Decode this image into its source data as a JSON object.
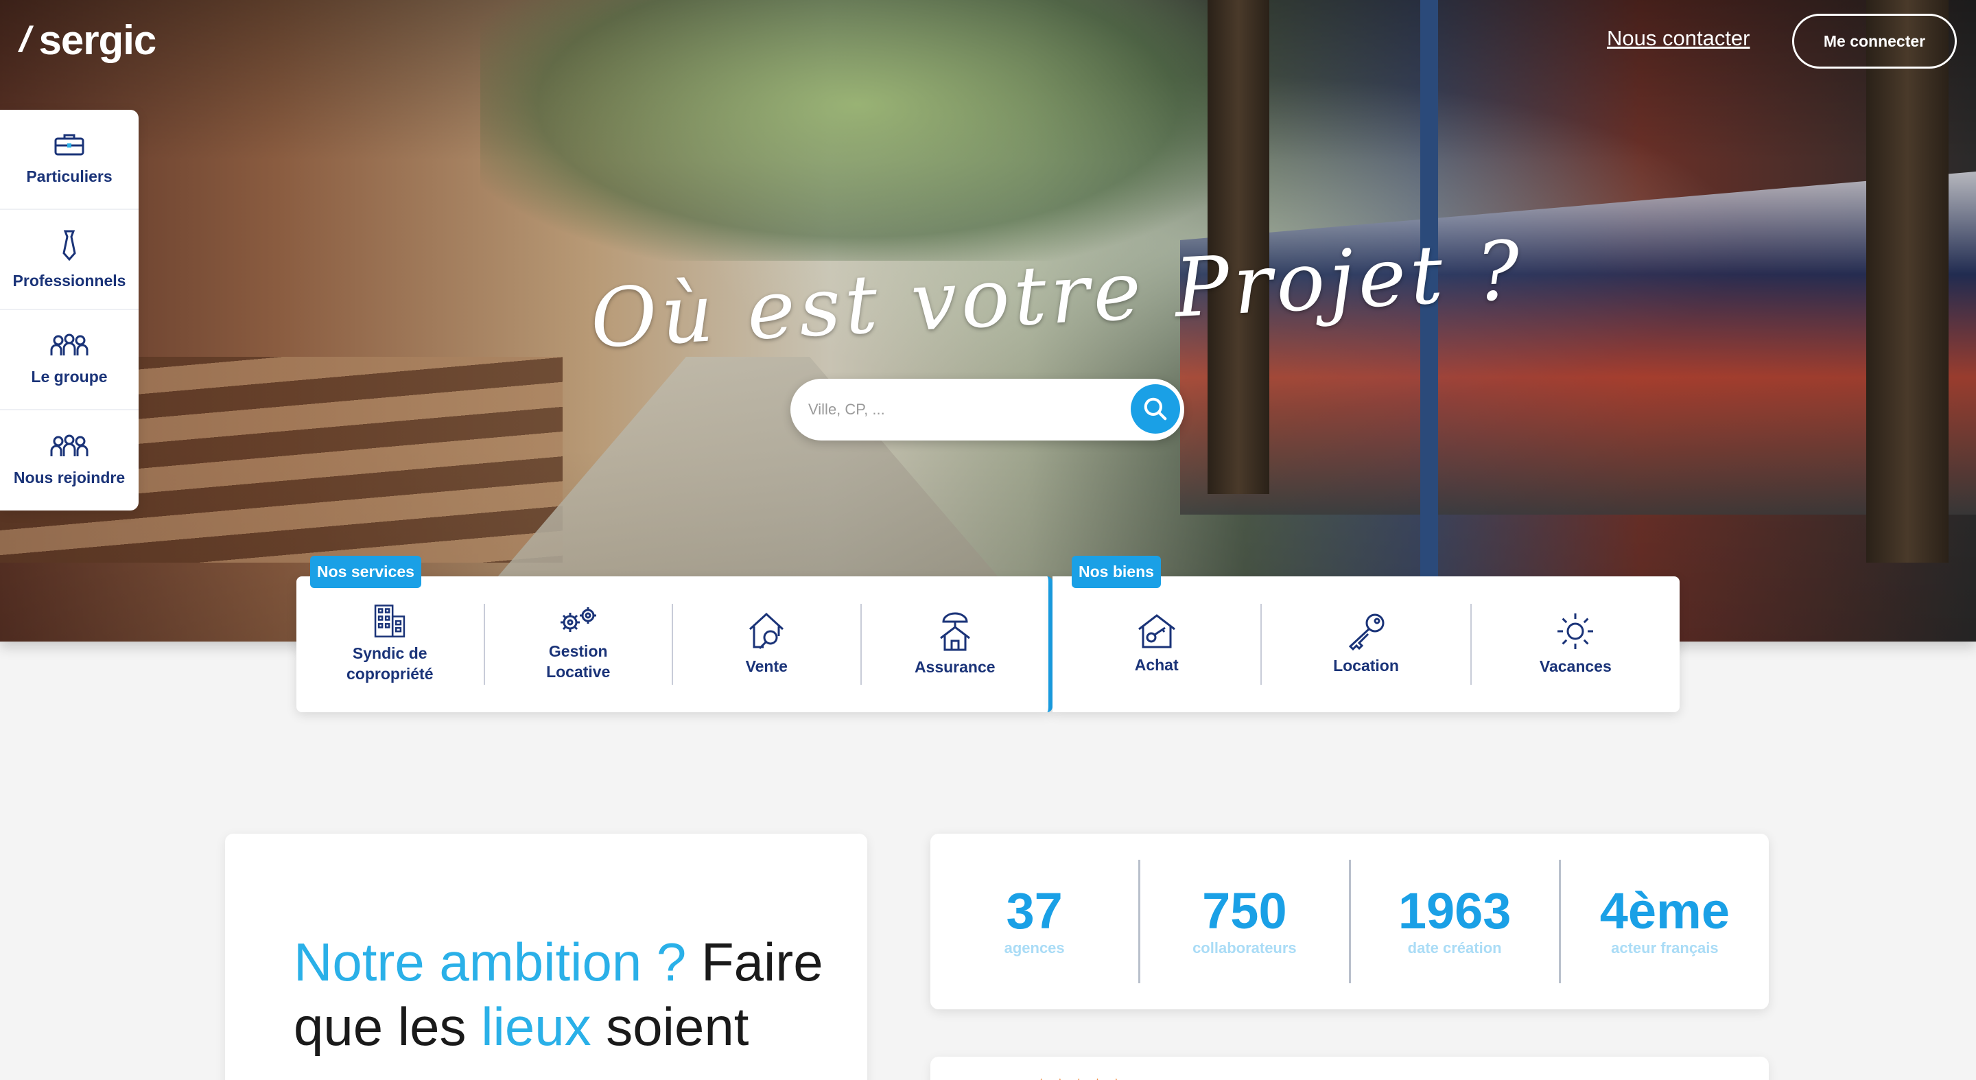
{
  "brand": {
    "name": "sergic",
    "slash": "/"
  },
  "header": {
    "contact_label": "Nous contacter",
    "login_label": "Me connecter"
  },
  "hero": {
    "headline": "Où est votre Projet ?"
  },
  "search": {
    "placeholder": "Ville, CP, ...",
    "button_icon": "search-icon"
  },
  "sidebar": {
    "items": [
      {
        "label": "Particuliers",
        "icon": "briefcase-icon"
      },
      {
        "label": "Professionnels",
        "icon": "tie-icon"
      },
      {
        "label": "Le groupe",
        "icon": "group-icon"
      },
      {
        "label": "Nous rejoindre",
        "icon": "people-icon"
      }
    ]
  },
  "services": {
    "tag": "Nos services",
    "items": [
      {
        "label": "Syndic de\ncopropriété",
        "icon": "building-icon"
      },
      {
        "label": "Gestion\nLocative",
        "icon": "gears-icon"
      },
      {
        "label": "Vente",
        "icon": "house-search-icon"
      },
      {
        "label": "Assurance",
        "icon": "house-umbrella-icon"
      }
    ]
  },
  "biens": {
    "tag": "Nos biens",
    "items": [
      {
        "label": "Achat",
        "icon": "house-key-icon"
      },
      {
        "label": "Location",
        "icon": "key-icon"
      },
      {
        "label": "Vacances",
        "icon": "sun-icon"
      }
    ]
  },
  "ambition": {
    "part1": "Notre ambition ?",
    "part2": " Faire que les ",
    "part3": "lieux",
    "part4": " soient"
  },
  "stats": [
    {
      "value": "37",
      "label": "agences"
    },
    {
      "value": "750",
      "label": "collaborateurs"
    },
    {
      "value": "1963",
      "label": "date création"
    },
    {
      "value": "4ème",
      "label": "acteur français"
    }
  ],
  "reviews": {
    "stars": "★★★★★"
  },
  "colors": {
    "accent": "#1aa0e6",
    "navy": "#1a3378",
    "stat_label": "#aadcf6",
    "star": "#f28a3c"
  }
}
